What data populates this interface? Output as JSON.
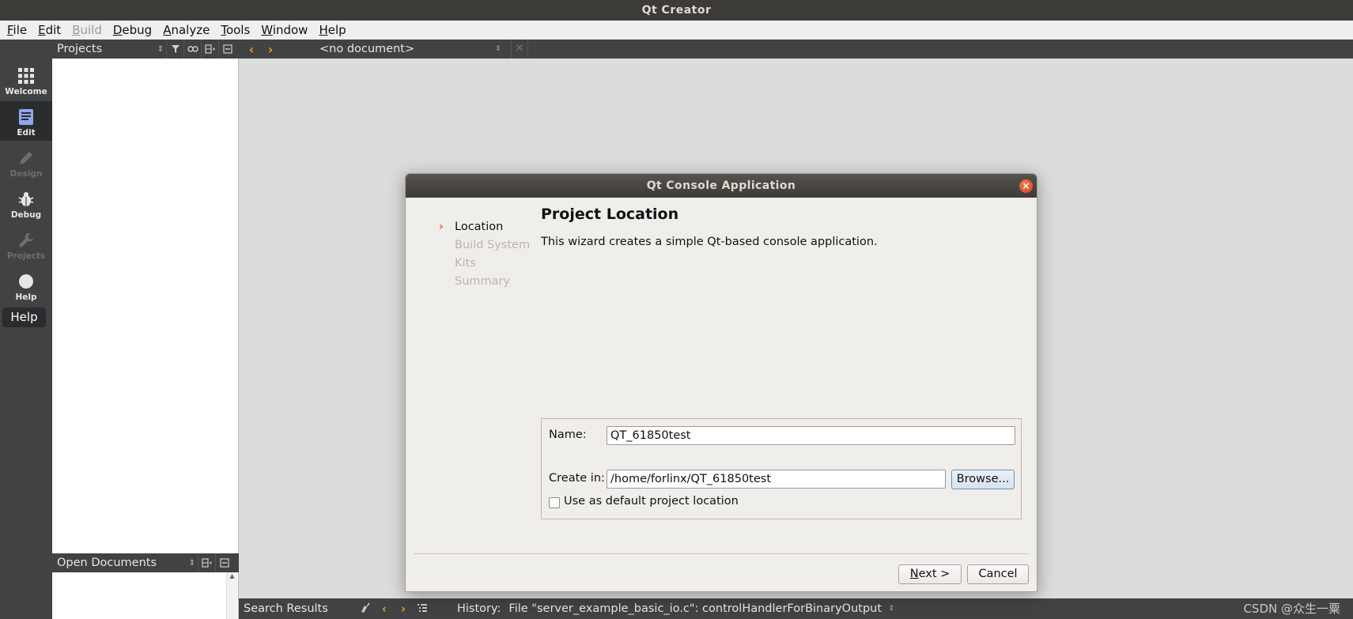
{
  "window": {
    "title": "Qt Creator"
  },
  "menubar": [
    {
      "label": "File",
      "mnemonic": "F",
      "rest": "ile",
      "enabled": true
    },
    {
      "label": "Edit",
      "mnemonic": "E",
      "rest": "dit",
      "enabled": true
    },
    {
      "label": "Build",
      "mnemonic": "B",
      "rest": "uild",
      "enabled": false
    },
    {
      "label": "Debug",
      "mnemonic": "D",
      "rest": "ebug",
      "enabled": true
    },
    {
      "label": "Analyze",
      "mnemonic": "A",
      "rest": "nalyze",
      "enabled": true
    },
    {
      "label": "Tools",
      "mnemonic": "T",
      "rest": "ools",
      "enabled": true
    },
    {
      "label": "Window",
      "mnemonic": "W",
      "rest": "indow",
      "enabled": true
    },
    {
      "label": "Help",
      "mnemonic": "H",
      "rest": "elp",
      "enabled": true
    }
  ],
  "modes": [
    {
      "label": "Welcome",
      "icon": "grid-icon",
      "state": "normal"
    },
    {
      "label": "Edit",
      "icon": "document-icon",
      "state": "active"
    },
    {
      "label": "Design",
      "icon": "pencil-icon",
      "state": "disabled"
    },
    {
      "label": "Debug",
      "icon": "bug-icon",
      "state": "normal"
    },
    {
      "label": "Projects",
      "icon": "wrench-icon",
      "state": "disabled"
    },
    {
      "label": "Help",
      "icon": "help-icon",
      "state": "normal"
    }
  ],
  "mode_tooltip": "Help",
  "sidebar": {
    "projects_title": "Projects",
    "open_documents_title": "Open Documents"
  },
  "editor": {
    "document_selector": "<no document>"
  },
  "statusbar": {
    "pane_title": "Search Results",
    "history_label": "History:",
    "history_value": "File \"server_example_basic_io.c\": controlHandlerForBinaryOutput"
  },
  "watermark": "CSDN @众生一粟",
  "dialog": {
    "title": "Qt Console Application",
    "steps": [
      "Location",
      "Build System",
      "Kits",
      "Summary"
    ],
    "current_step": 0,
    "page_title": "Project Location",
    "description": "This wizard creates a simple Qt-based console application.",
    "name_label": "Name:",
    "name_value": "QT_61850test",
    "create_in_label": "Create in:",
    "create_in_value": "/home/forlinx/QT_61850test",
    "browse_label": "Browse...",
    "default_location_label": "Use as default project location",
    "default_location_checked": false,
    "next_label": "Next >",
    "next_mnemonic": "N",
    "next_rest": "ext >",
    "cancel_label": "Cancel"
  },
  "colors": {
    "accent": "#e0612a",
    "nav_arrow": "#e8a020",
    "dark_panel": "#404244",
    "title_bar": "#3c3b37"
  }
}
